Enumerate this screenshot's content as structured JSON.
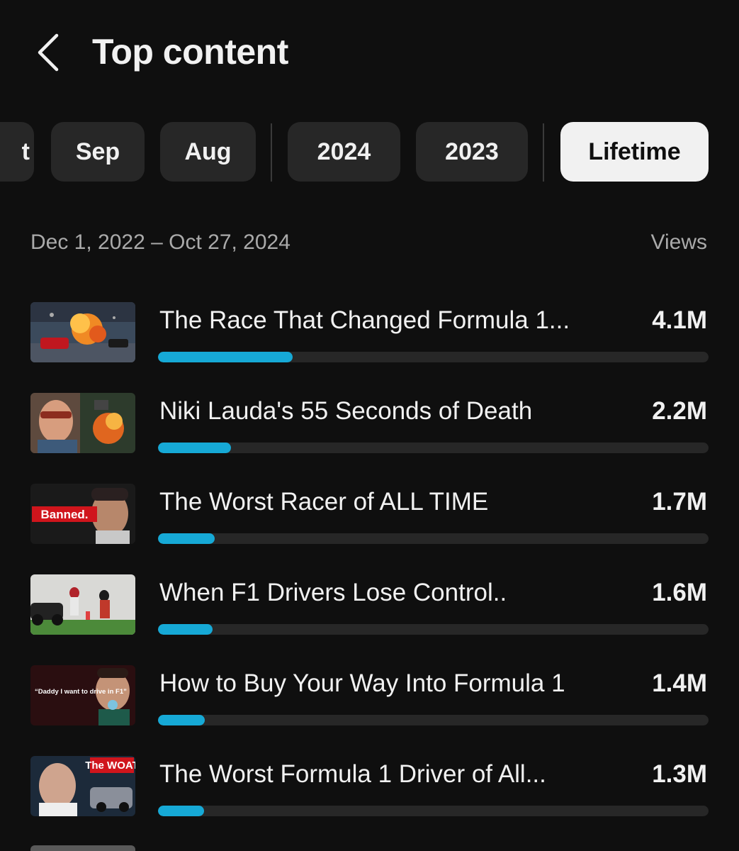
{
  "header": {
    "title": "Top content"
  },
  "filters": {
    "chips": [
      {
        "label": "Oct",
        "display": "t",
        "active": false
      },
      {
        "label": "Sep",
        "active": false
      },
      {
        "label": "Aug",
        "active": false
      },
      {
        "label": "2024",
        "active": false
      },
      {
        "label": "2023",
        "active": false
      },
      {
        "label": "Lifetime",
        "active": true
      }
    ]
  },
  "summary": {
    "date_range": "Dec 1, 2022 – Oct 27, 2024",
    "metric_label": "Views"
  },
  "colors": {
    "accent": "#16a9d6",
    "background": "#0f0f0f",
    "chip": "#272727",
    "chip_active": "#f1f1f1"
  },
  "videos": [
    {
      "title": "The Race That Changed Formula 1...",
      "views": "4.1M",
      "share": 0.244,
      "thumb_text": ""
    },
    {
      "title": "Niki Lauda's 55 Seconds of Death",
      "views": "2.2M",
      "share": 0.133,
      "thumb_text": ""
    },
    {
      "title": "The Worst Racer of ALL TIME",
      "views": "1.7M",
      "share": 0.103,
      "thumb_text": "Banned."
    },
    {
      "title": "When F1 Drivers Lose Control..",
      "views": "1.6M",
      "share": 0.099,
      "thumb_text": ""
    },
    {
      "title": "How to Buy Your Way Into Formula 1",
      "views": "1.4M",
      "share": 0.085,
      "thumb_text": "“Daddy I want to drive in F1”"
    },
    {
      "title": "The Worst Formula 1 Driver of All...",
      "views": "1.3M",
      "share": 0.084,
      "thumb_text": "The WOAT"
    }
  ]
}
